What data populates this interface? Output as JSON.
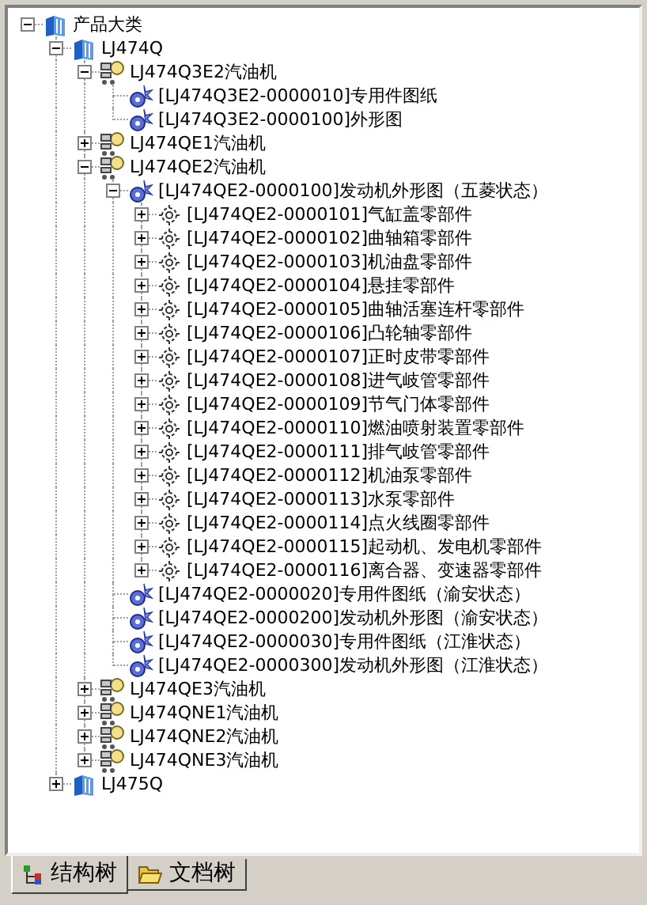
{
  "tree": [
    {
      "label": "产品大类",
      "kind": "category",
      "expanded": true,
      "children": [
        {
          "label": "LJ474Q",
          "kind": "category",
          "expanded": true,
          "children": [
            {
              "label": "LJ474Q3E2汽油机",
              "kind": "engine",
              "expanded": true,
              "children": [
                {
                  "label": "[LJ474Q3E2-0000010]专用件图纸",
                  "kind": "document"
                },
                {
                  "label": "[LJ474Q3E2-0000100]外形图",
                  "kind": "document"
                }
              ]
            },
            {
              "label": "LJ474QE1汽油机",
              "kind": "engine",
              "expanded": false
            },
            {
              "label": "LJ474QE2汽油机",
              "kind": "engine",
              "expanded": true,
              "children": [
                {
                  "label": "[LJ474QE2-0000100]发动机外形图（五菱状态）",
                  "kind": "document",
                  "expanded": true,
                  "children": [
                    {
                      "label": "[LJ474QE2-0000101]气缸盖零部件",
                      "kind": "part",
                      "expanded": false
                    },
                    {
                      "label": "[LJ474QE2-0000102]曲轴箱零部件",
                      "kind": "part",
                      "expanded": false
                    },
                    {
                      "label": "[LJ474QE2-0000103]机油盘零部件",
                      "kind": "part",
                      "expanded": false
                    },
                    {
                      "label": "[LJ474QE2-0000104]悬挂零部件",
                      "kind": "part",
                      "expanded": false
                    },
                    {
                      "label": "[LJ474QE2-0000105]曲轴活塞连杆零部件",
                      "kind": "part",
                      "expanded": false
                    },
                    {
                      "label": "[LJ474QE2-0000106]凸轮轴零部件",
                      "kind": "part",
                      "expanded": false
                    },
                    {
                      "label": "[LJ474QE2-0000107]正时皮带零部件",
                      "kind": "part",
                      "expanded": false
                    },
                    {
                      "label": "[LJ474QE2-0000108]进气岐管零部件",
                      "kind": "part",
                      "expanded": false
                    },
                    {
                      "label": "[LJ474QE2-0000109]节气门体零部件",
                      "kind": "part",
                      "expanded": false
                    },
                    {
                      "label": "[LJ474QE2-0000110]燃油喷射装置零部件",
                      "kind": "part",
                      "expanded": false
                    },
                    {
                      "label": "[LJ474QE2-0000111]排气岐管零部件",
                      "kind": "part",
                      "expanded": false
                    },
                    {
                      "label": "[LJ474QE2-0000112]机油泵零部件",
                      "kind": "part",
                      "expanded": false
                    },
                    {
                      "label": "[LJ474QE2-0000113]水泵零部件",
                      "kind": "part",
                      "expanded": false
                    },
                    {
                      "label": "[LJ474QE2-0000114]点火线圈零部件",
                      "kind": "part",
                      "expanded": false
                    },
                    {
                      "label": "[LJ474QE2-0000115]起动机、发电机零部件",
                      "kind": "part",
                      "expanded": false
                    },
                    {
                      "label": "[LJ474QE2-0000116]离合器、变速器零部件",
                      "kind": "part",
                      "expanded": false
                    }
                  ]
                },
                {
                  "label": "[LJ474QE2-0000020]专用件图纸（渝安状态）",
                  "kind": "document"
                },
                {
                  "label": "[LJ474QE2-0000200]发动机外形图（渝安状态）",
                  "kind": "document"
                },
                {
                  "label": "[LJ474QE2-0000030]专用件图纸（江淮状态）",
                  "kind": "document"
                },
                {
                  "label": "[LJ474QE2-0000300]发动机外形图（江淮状态）",
                  "kind": "document"
                }
              ]
            },
            {
              "label": "LJ474QE3汽油机",
              "kind": "engine",
              "expanded": false
            },
            {
              "label": "LJ474QNE1汽油机",
              "kind": "engine",
              "expanded": false
            },
            {
              "label": "LJ474QNE2汽油机",
              "kind": "engine",
              "expanded": false
            },
            {
              "label": "LJ474QNE3汽油机",
              "kind": "engine",
              "expanded": false
            }
          ]
        },
        {
          "label": "LJ475Q",
          "kind": "category",
          "expanded": false
        }
      ]
    }
  ],
  "tabs": [
    {
      "label": "结构树",
      "selected": true,
      "kind": "structure"
    },
    {
      "label": "文档树",
      "selected": false,
      "kind": "folder"
    }
  ]
}
